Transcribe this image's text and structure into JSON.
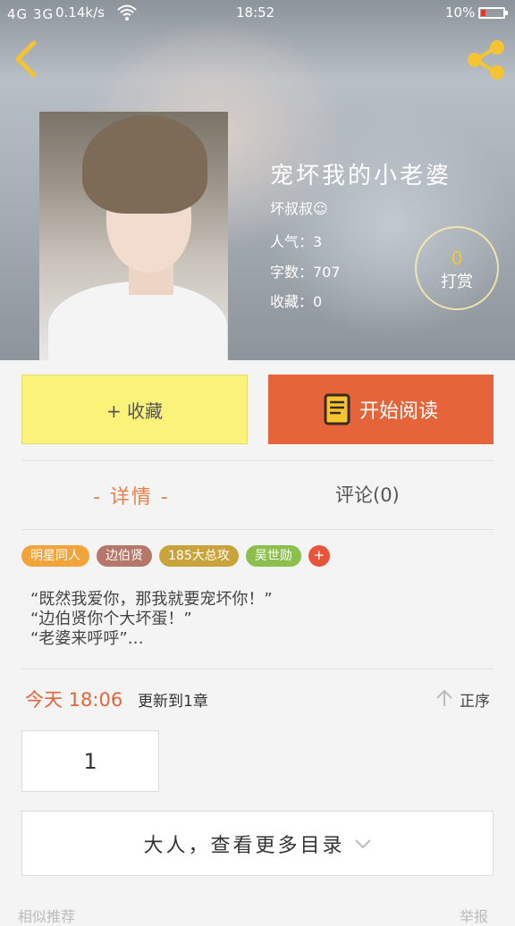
{
  "status_bar": {
    "signal": "4G 3G",
    "net_speed": "0.14k/s",
    "time": "18:52",
    "battery": "10%",
    "battery_level": 0.1,
    "battery_color": "#e03a2f"
  },
  "book": {
    "title": "宠坏我的小老婆",
    "author": "坏叔叔☺",
    "popularity": "人气：3",
    "word_count": "字数：707",
    "favorites": "收藏：0",
    "reward_count": "0",
    "reward_label": "打赏"
  },
  "actions": {
    "favorite_label": "+ 收藏",
    "read_label": "开始阅读",
    "favorite_color": "#fbf27a",
    "read_color": "#e6643a"
  },
  "tabs": {
    "details": "- 详情 -",
    "comments": "评论(0)"
  },
  "tags": [
    {
      "label": "明星同人",
      "color": "#f2a43a"
    },
    {
      "label": "边伯贤",
      "color": "#b4776a"
    },
    {
      "label": "185大总攻",
      "color": "#c9a33b"
    },
    {
      "label": "吴世勋",
      "color": "#8cbf4e"
    }
  ],
  "tag_more": "+",
  "synopsis": [
    "“既然我爱你，那我就要宠坏你！”",
    "“边伯贤你个大坏蛋！”",
    "“老婆来呼呼”…"
  ],
  "update": {
    "time": "今天 18:06",
    "text": "更新到1章",
    "sort_label": "正序"
  },
  "chapters": [
    "1"
  ],
  "more_catalog": "大人，查看更多目录",
  "footer": {
    "left": "相似推荐",
    "right": "举报"
  },
  "icons": {
    "back": "chevron-left-icon",
    "share": "share-icon",
    "book": "book-icon",
    "sort": "arrow-up-icon",
    "more": "chevron-down-icon",
    "accent": "#f4c433"
  }
}
